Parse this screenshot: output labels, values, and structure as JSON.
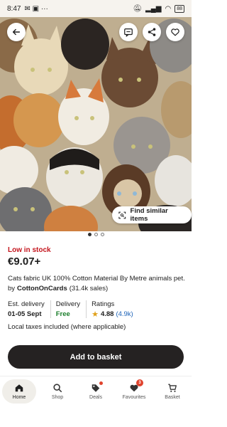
{
  "status_bar": {
    "time": "8:47",
    "battery": "88"
  },
  "hero": {
    "find_similar_label": "Find similar items"
  },
  "carousel": {
    "count": 3,
    "active_index": 0
  },
  "product": {
    "stock_status": "Low in stock",
    "price": "€9.07+",
    "title": "Cats fabric UK 100% Cotton Material By Metre animals pet...",
    "by_label": "by",
    "seller": "CottonOnCards",
    "sales": "(31.4k sales)"
  },
  "info": {
    "delivery_label": "Est. delivery",
    "delivery_dates": "01-05 Sept",
    "shipping_label": "Delivery",
    "shipping_value": "Free",
    "ratings_label": "Ratings",
    "rating_value": "4.88",
    "rating_count": "(4.9k)"
  },
  "taxes_note": "Local taxes included (where applicable)",
  "cta": {
    "add_to_basket": "Add to basket"
  },
  "nav": {
    "items": [
      {
        "label": "Home",
        "icon": "home-icon",
        "active": true
      },
      {
        "label": "Shop",
        "icon": "search-icon"
      },
      {
        "label": "Deals",
        "icon": "tag-icon"
      },
      {
        "label": "Favourites",
        "icon": "heart-icon",
        "badge": "3"
      },
      {
        "label": "Basket",
        "icon": "cart-icon"
      }
    ]
  },
  "colors": {
    "stock_red": "#c4141c",
    "free_green": "#1a7d2a",
    "rating_blue": "#1c63b8",
    "star": "#e0a019",
    "cta_bg": "#252222",
    "badge": "#e0432d"
  }
}
